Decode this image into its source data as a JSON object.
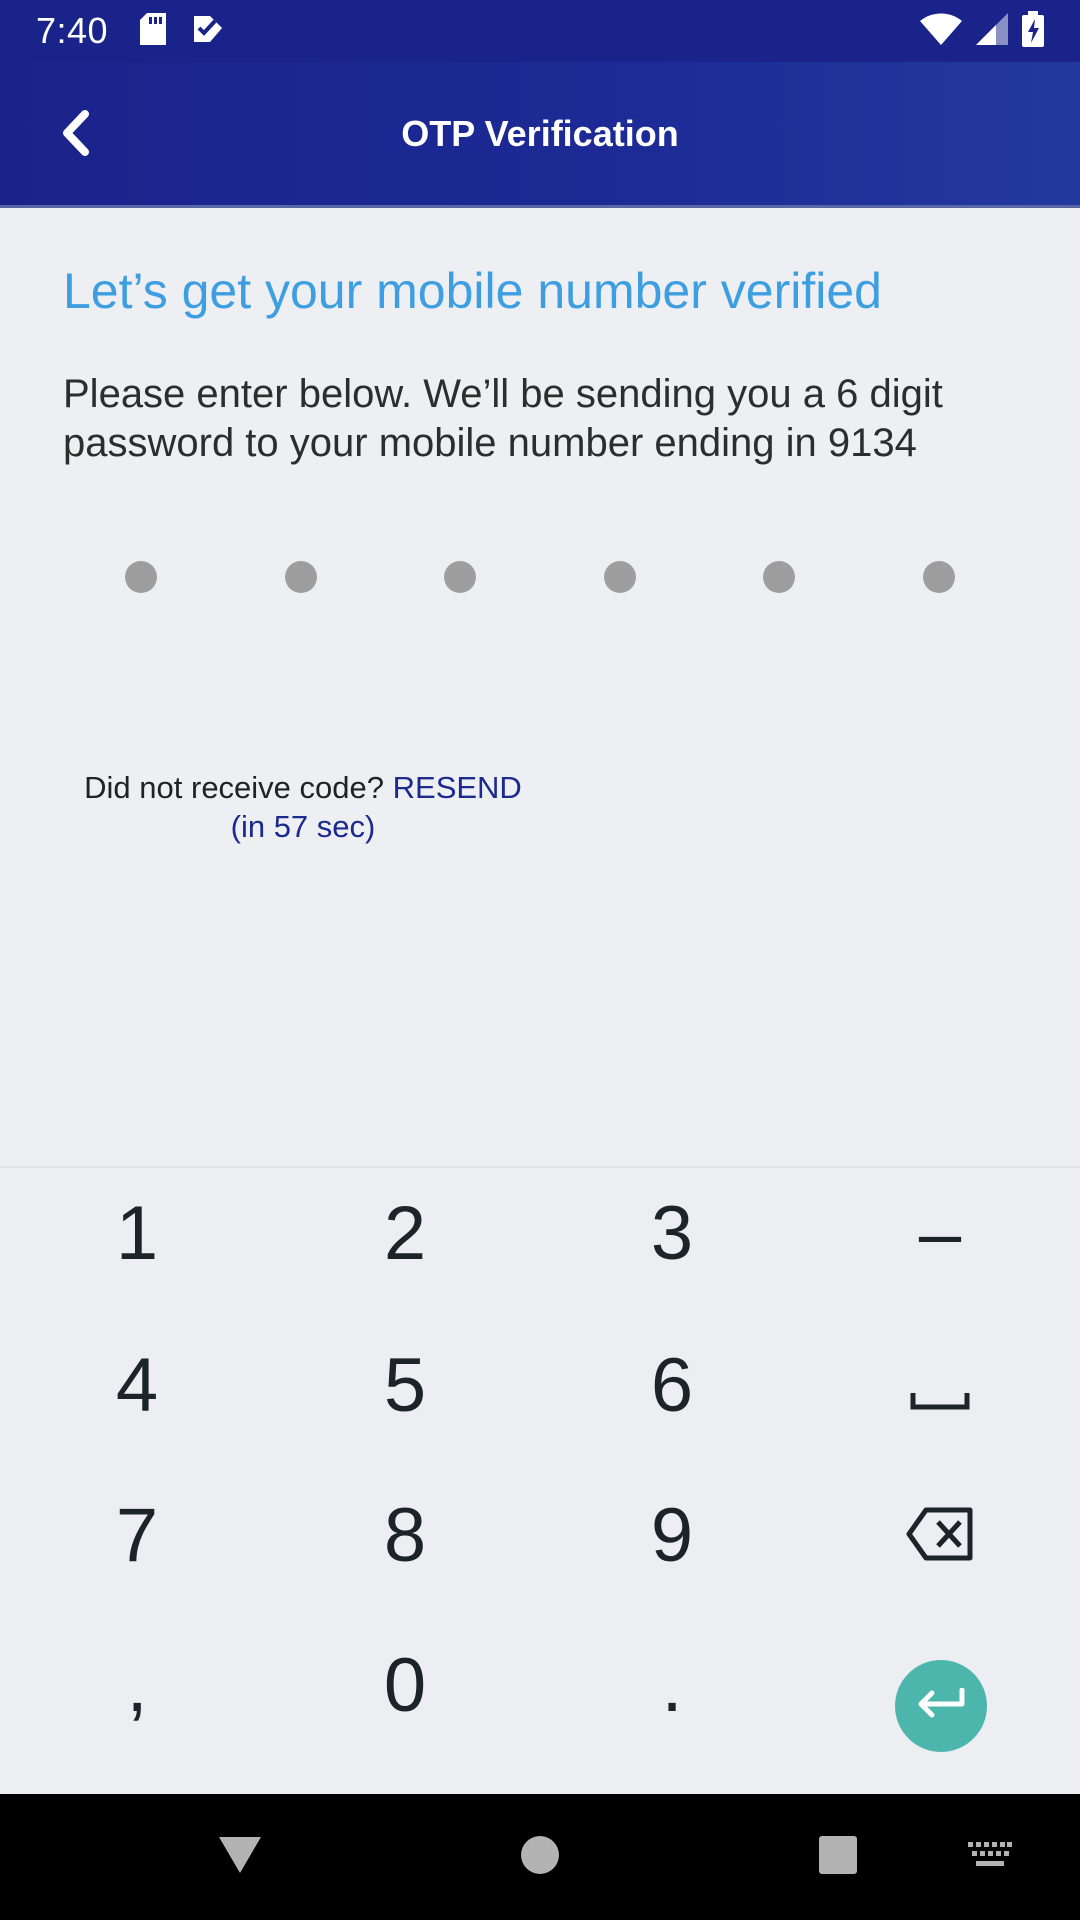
{
  "status_bar": {
    "time": "7:40",
    "left_icons": [
      "sd-card-icon",
      "check-badge-icon"
    ],
    "right_icons": [
      "wifi-icon",
      "signal-icon",
      "battery-charging-icon"
    ]
  },
  "app_bar": {
    "title": "OTP Verification",
    "back_icon": "chevron-left-icon"
  },
  "content": {
    "heading": "Let’s get your mobile number verified",
    "description": "Please enter below. We’ll be sending you a 6 digit password to your mobile number ending in 9134",
    "otp_length": 6,
    "resend_prefix": "Did not receive code? ",
    "resend_link": "RESEND (in 57 sec)"
  },
  "keyboard": {
    "keys": [
      {
        "label": "1",
        "name": "key-1"
      },
      {
        "label": "2",
        "name": "key-2"
      },
      {
        "label": "3",
        "name": "key-3"
      },
      {
        "label": "–",
        "name": "key-dash"
      },
      {
        "label": "4",
        "name": "key-4"
      },
      {
        "label": "5",
        "name": "key-5"
      },
      {
        "label": "6",
        "name": "key-6"
      },
      {
        "label": "",
        "name": "space-key",
        "icon": "space-bar-icon"
      },
      {
        "label": "7",
        "name": "key-7"
      },
      {
        "label": "8",
        "name": "key-8"
      },
      {
        "label": "9",
        "name": "key-9"
      },
      {
        "label": "",
        "name": "backspace-key",
        "icon": "backspace-icon"
      },
      {
        "label": ",",
        "name": "key-comma"
      },
      {
        "label": "0",
        "name": "key-0"
      },
      {
        "label": ".",
        "name": "key-period"
      }
    ],
    "enter_icon": "enter-icon",
    "enter_color": "#4db6ac"
  },
  "nav_bar": {
    "items": [
      "back-triangle-icon",
      "home-circle-icon",
      "recents-square-icon",
      "keyboard-icon"
    ]
  },
  "colors": {
    "status_bar": "#1a238a",
    "heading": "#3d9ee2",
    "link": "#1b2a8e",
    "background": "#eeeff3"
  }
}
